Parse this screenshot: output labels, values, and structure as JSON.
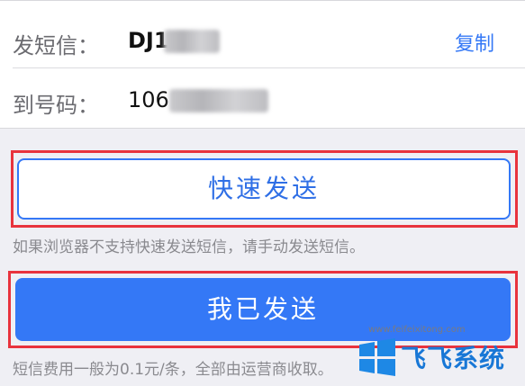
{
  "sms": {
    "send_label": "发短信：",
    "send_value": "DJ1",
    "copy_label": "复制",
    "to_label": "到号码：",
    "to_value": "106"
  },
  "quick_send": {
    "label": "快速发送",
    "hint": "如果浏览器不支持快速发送短信，请手动发送短信。"
  },
  "confirm": {
    "label": "我已发送",
    "fee_note": "短信费用一般为0.1元/条，全部由运营商收取。"
  },
  "colors": {
    "accent": "#3478f6",
    "highlight_border": "#e8333d",
    "background": "#efeff4"
  },
  "watermark": {
    "url": "www.feifeixitong.com",
    "text": "飞飞系统",
    "icon": "windows-logo-icon"
  }
}
